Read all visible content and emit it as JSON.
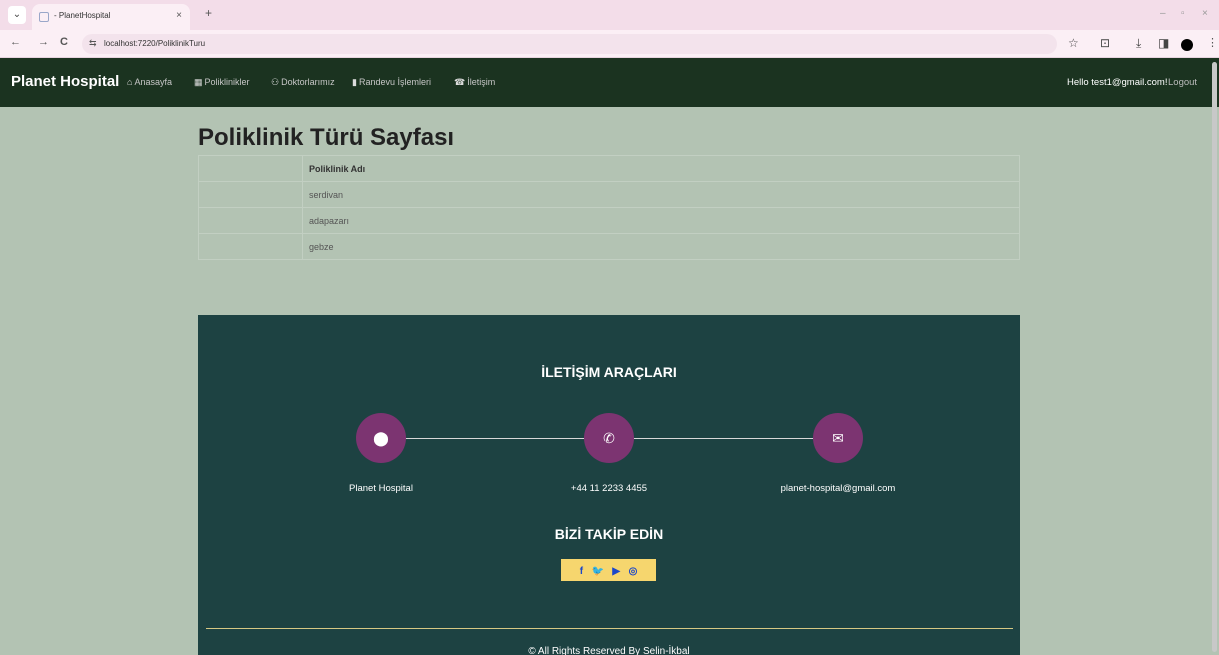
{
  "browser": {
    "tab_title": "- PlanetHospital",
    "tab_close": "×",
    "new_tab": "+",
    "url": "localhost:7220/PoliklinikTuru",
    "nav_back": "←",
    "nav_forward": "→",
    "nav_reload": "C",
    "site_info": "⇆",
    "star": "☆",
    "extensions": "⊡",
    "download": "⤓",
    "sidepanel": "◨",
    "menu": "⋮",
    "minimize": "–",
    "restore": "▫",
    "close": "×",
    "tab_dropdown": "⌄"
  },
  "navbar": {
    "brand": "Planet Hospital",
    "links": [
      {
        "icon": "⌂",
        "label": "Anasayfa"
      },
      {
        "icon": "▦",
        "label": "Poliklinikler"
      },
      {
        "icon": "⚇",
        "label": "Doktorlarımız"
      },
      {
        "icon": "▮",
        "label": "Randevu İşlemleri"
      },
      {
        "icon": "☎",
        "label": "İletişim"
      }
    ],
    "hello": "Hello test1@gmail.com!",
    "logout": "Logout"
  },
  "main": {
    "title": "Poliklinik Türü Sayfası",
    "table": {
      "header": "Poliklinik Adı",
      "rows": [
        "serdivan",
        "adapazarı",
        "gebze"
      ]
    }
  },
  "footer": {
    "contact_title": "İLETİŞİM ARAÇLARI",
    "contacts": [
      {
        "icon": "⬤",
        "label": "Planet Hospital"
      },
      {
        "icon": "✆",
        "label": "+44 11 2233 4455"
      },
      {
        "icon": "✉",
        "label": "planet-hospital@gmail.com"
      }
    ],
    "follow_title": "BİZİ TAKİP EDİN",
    "social": [
      {
        "icon": "f"
      },
      {
        "icon": "🐦"
      },
      {
        "icon": "▶"
      },
      {
        "icon": "◎"
      }
    ],
    "copyright": "© All Rights Reserved By Selin-İkbal"
  },
  "colors": {
    "page_bg": "#b3c3b3",
    "navbar_bg": "#1b3320",
    "footer_bg": "#1d4242",
    "circle": "#7c3471",
    "social_bg": "#f6d66e"
  }
}
